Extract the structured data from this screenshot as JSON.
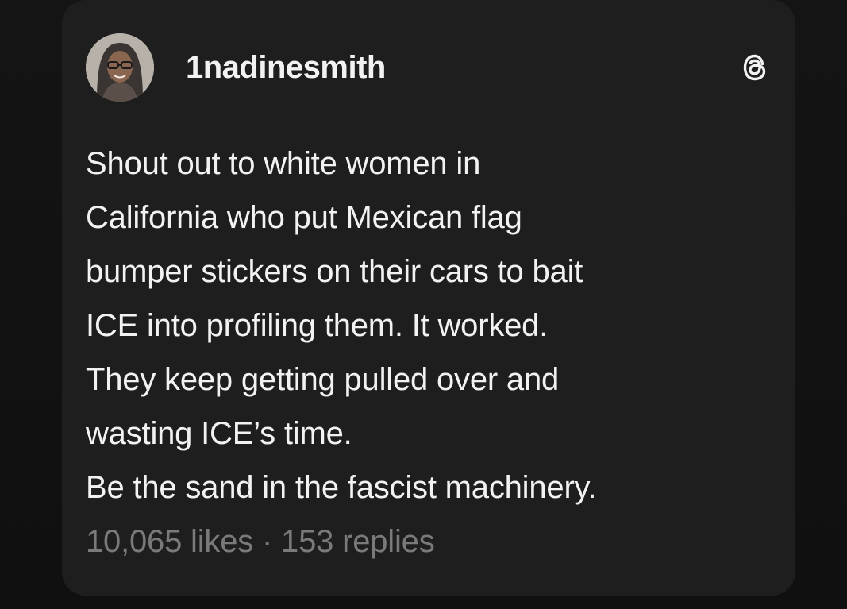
{
  "post": {
    "username": "1nadinesmith",
    "avatar_icon": "profile-photo",
    "platform_icon": "threads-icon",
    "text": "Shout out to white women in\nCalifornia who put Mexican flag\nbumper stickers on their cars to bait\nICE into profiling them. It worked.\nThey keep getting pulled over and\nwasting ICE’s time.\nBe the sand in the fascist machinery.",
    "likes": "10,065 likes",
    "separator": " · ",
    "replies": "153 replies"
  },
  "colors": {
    "background": "#101010",
    "card": "#1e1e1e",
    "text": "#f2f2f2",
    "muted": "#7a7a7a"
  }
}
